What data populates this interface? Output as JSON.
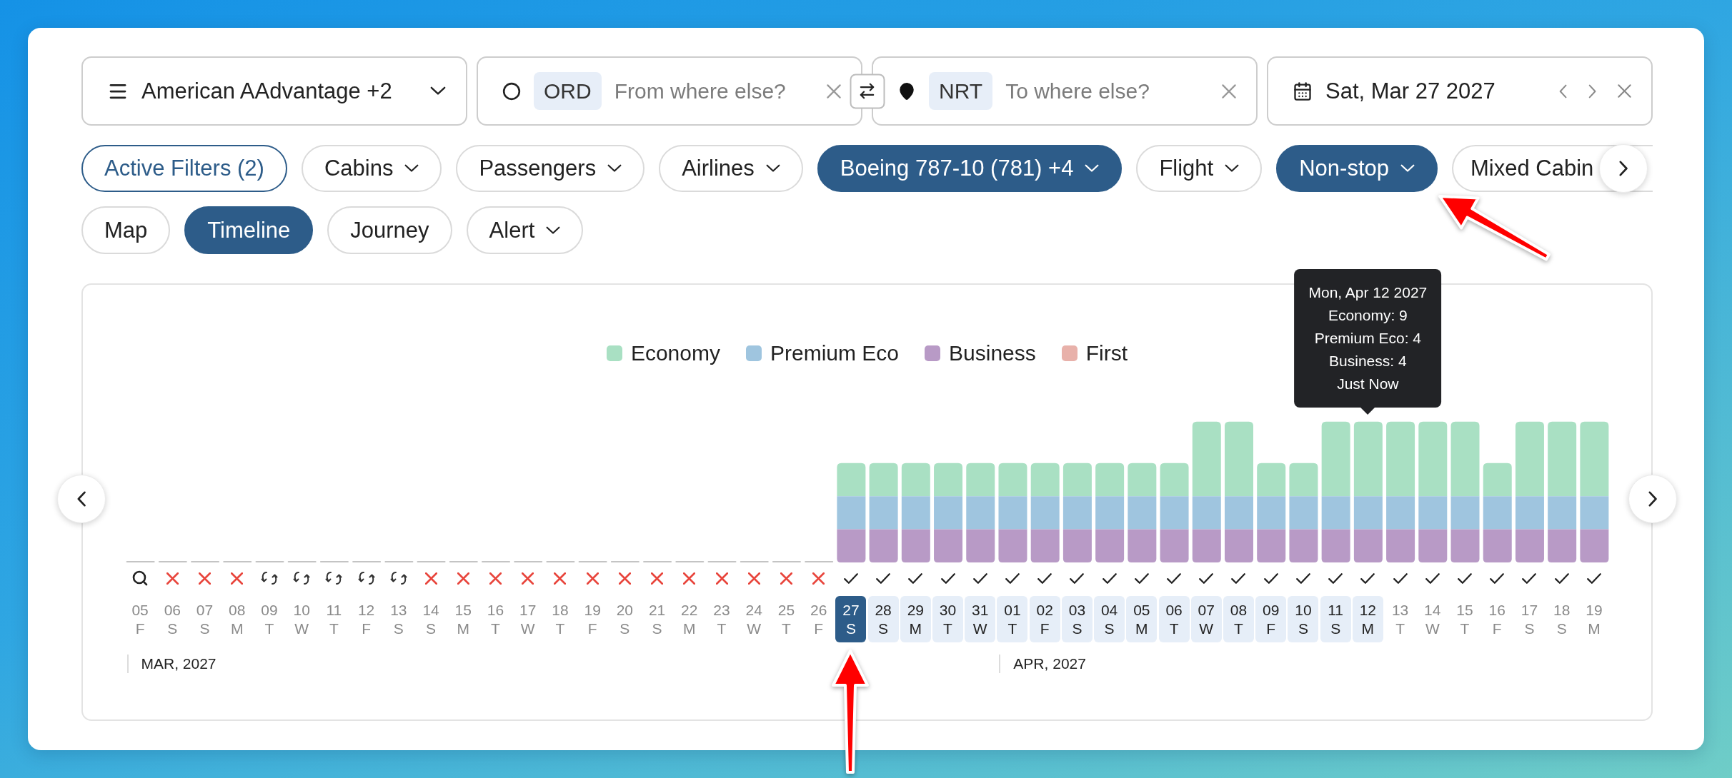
{
  "search": {
    "program": {
      "label": "American AAdvantage +2"
    },
    "origin": {
      "code": "ORD",
      "placeholder": "From where else?"
    },
    "destination": {
      "code": "NRT",
      "placeholder": "To where else?"
    },
    "date": {
      "value": "Sat, Mar 27 2027"
    }
  },
  "filters": [
    {
      "kind": "summary",
      "label": "Active Filters (2)"
    },
    {
      "kind": "filter",
      "label": "Cabins",
      "active": false,
      "dropdown": true
    },
    {
      "kind": "filter",
      "label": "Passengers",
      "active": false,
      "dropdown": true
    },
    {
      "kind": "filter",
      "label": "Airlines",
      "active": false,
      "dropdown": true
    },
    {
      "kind": "filter",
      "label": "Boeing 787-10 (781) +4",
      "active": true,
      "dropdown": true
    },
    {
      "kind": "filter",
      "label": "Flight",
      "active": false,
      "dropdown": true
    },
    {
      "kind": "filter",
      "label": "Non-stop",
      "active": true,
      "dropdown": true
    },
    {
      "kind": "filter",
      "label": "Mixed Cabin",
      "active": false,
      "dropdown": false
    }
  ],
  "views": [
    {
      "label": "Map",
      "selected": false,
      "dropdown": false
    },
    {
      "label": "Timeline",
      "selected": true,
      "dropdown": false
    },
    {
      "label": "Journey",
      "selected": false,
      "dropdown": false
    },
    {
      "label": "Alert",
      "selected": false,
      "dropdown": true
    }
  ],
  "timeline": {
    "legend": [
      {
        "label": "Economy",
        "color": "#a9e0c3"
      },
      {
        "label": "Premium Eco",
        "color": "#9fc5df"
      },
      {
        "label": "Business",
        "color": "#b89ac6"
      },
      {
        "label": "First",
        "color": "#e8b1aa"
      }
    ],
    "months": [
      {
        "label": "MAR, 2027",
        "days": [
          {
            "day": "05",
            "weekday": "F",
            "kind": "search",
            "selected": false,
            "in_range": false
          },
          {
            "day": "06",
            "weekday": "S",
            "kind": "none",
            "selected": false,
            "in_range": false
          },
          {
            "day": "07",
            "weekday": "S",
            "kind": "none",
            "selected": false,
            "in_range": false
          },
          {
            "day": "08",
            "weekday": "M",
            "kind": "none",
            "selected": false,
            "in_range": false
          },
          {
            "day": "09",
            "weekday": "T",
            "kind": "pending",
            "selected": false,
            "in_range": false
          },
          {
            "day": "10",
            "weekday": "W",
            "kind": "pending",
            "selected": false,
            "in_range": false
          },
          {
            "day": "11",
            "weekday": "T",
            "kind": "pending",
            "selected": false,
            "in_range": false
          },
          {
            "day": "12",
            "weekday": "F",
            "kind": "pending",
            "selected": false,
            "in_range": false
          },
          {
            "day": "13",
            "weekday": "S",
            "kind": "pending",
            "selected": false,
            "in_range": false
          },
          {
            "day": "14",
            "weekday": "S",
            "kind": "none",
            "selected": false,
            "in_range": false
          },
          {
            "day": "15",
            "weekday": "M",
            "kind": "none",
            "selected": false,
            "in_range": false
          },
          {
            "day": "16",
            "weekday": "T",
            "kind": "none",
            "selected": false,
            "in_range": false
          },
          {
            "day": "17",
            "weekday": "W",
            "kind": "none",
            "selected": false,
            "in_range": false
          },
          {
            "day": "18",
            "weekday": "T",
            "kind": "none",
            "selected": false,
            "in_range": false
          },
          {
            "day": "19",
            "weekday": "F",
            "kind": "none",
            "selected": false,
            "in_range": false
          },
          {
            "day": "20",
            "weekday": "S",
            "kind": "none",
            "selected": false,
            "in_range": false
          },
          {
            "day": "21",
            "weekday": "S",
            "kind": "none",
            "selected": false,
            "in_range": false
          },
          {
            "day": "22",
            "weekday": "M",
            "kind": "none",
            "selected": false,
            "in_range": false
          },
          {
            "day": "23",
            "weekday": "T",
            "kind": "none",
            "selected": false,
            "in_range": false
          },
          {
            "day": "24",
            "weekday": "W",
            "kind": "none",
            "selected": false,
            "in_range": false
          },
          {
            "day": "25",
            "weekday": "T",
            "kind": "none",
            "selected": false,
            "in_range": false
          },
          {
            "day": "26",
            "weekday": "F",
            "kind": "none",
            "selected": false,
            "in_range": false
          },
          {
            "day": "27",
            "weekday": "S",
            "kind": "available",
            "selected": true,
            "in_range": true
          },
          {
            "day": "28",
            "weekday": "S",
            "kind": "available",
            "selected": false,
            "in_range": true
          },
          {
            "day": "29",
            "weekday": "M",
            "kind": "available",
            "selected": false,
            "in_range": true
          },
          {
            "day": "30",
            "weekday": "T",
            "kind": "available",
            "selected": false,
            "in_range": true
          },
          {
            "day": "31",
            "weekday": "W",
            "kind": "available",
            "selected": false,
            "in_range": true
          }
        ]
      },
      {
        "label": "APR, 2027",
        "days": [
          {
            "day": "01",
            "weekday": "T",
            "kind": "available",
            "selected": false,
            "in_range": true
          },
          {
            "day": "02",
            "weekday": "F",
            "kind": "available",
            "selected": false,
            "in_range": true
          },
          {
            "day": "03",
            "weekday": "S",
            "kind": "available",
            "selected": false,
            "in_range": true
          },
          {
            "day": "04",
            "weekday": "S",
            "kind": "available",
            "selected": false,
            "in_range": true
          },
          {
            "day": "05",
            "weekday": "M",
            "kind": "available",
            "selected": false,
            "in_range": true
          },
          {
            "day": "06",
            "weekday": "T",
            "kind": "available",
            "selected": false,
            "in_range": true
          },
          {
            "day": "07",
            "weekday": "W",
            "kind": "available",
            "selected": false,
            "in_range": true
          },
          {
            "day": "08",
            "weekday": "T",
            "kind": "available",
            "selected": false,
            "in_range": true
          },
          {
            "day": "09",
            "weekday": "F",
            "kind": "available",
            "selected": false,
            "in_range": true
          },
          {
            "day": "10",
            "weekday": "S",
            "kind": "available",
            "selected": false,
            "in_range": true
          },
          {
            "day": "11",
            "weekday": "S",
            "kind": "available",
            "selected": false,
            "in_range": true
          },
          {
            "day": "12",
            "weekday": "M",
            "kind": "available",
            "selected": false,
            "in_range": true,
            "tooltip": [
              "Mon, Apr 12 2027",
              "Economy: 9",
              "Premium Eco: 4",
              "Business: 4",
              "Just Now"
            ]
          },
          {
            "day": "13",
            "weekday": "T",
            "kind": "available",
            "selected": false,
            "in_range": false
          },
          {
            "day": "14",
            "weekday": "W",
            "kind": "available",
            "selected": false,
            "in_range": false
          },
          {
            "day": "15",
            "weekday": "T",
            "kind": "available",
            "selected": false,
            "in_range": false
          },
          {
            "day": "16",
            "weekday": "F",
            "kind": "available",
            "selected": false,
            "in_range": false
          },
          {
            "day": "17",
            "weekday": "S",
            "kind": "available",
            "selected": false,
            "in_range": false
          },
          {
            "day": "18",
            "weekday": "S",
            "kind": "available",
            "selected": false,
            "in_range": false
          },
          {
            "day": "19",
            "weekday": "M",
            "kind": "available",
            "selected": false,
            "in_range": false
          }
        ]
      }
    ]
  }
}
